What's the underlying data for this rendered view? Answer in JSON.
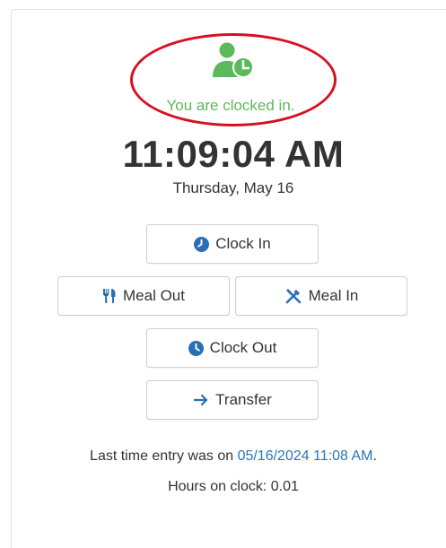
{
  "status": {
    "text": "You are clocked in.",
    "icon": "user-clock-icon",
    "color": "#5cb85c",
    "highlight_color": "#d8101e"
  },
  "clock": {
    "time": "11:09:04 AM",
    "date": "Thursday, May 16"
  },
  "buttons": {
    "clock_in": {
      "label": "Clock In",
      "icon": "clock-icon"
    },
    "meal_out": {
      "label": "Meal Out",
      "icon": "utensils-icon"
    },
    "meal_in": {
      "label": "Meal In",
      "icon": "crossed-utensils-icon"
    },
    "clock_out": {
      "label": "Clock Out",
      "icon": "clock-icon"
    },
    "transfer": {
      "label": "Transfer",
      "icon": "arrow-right-icon"
    }
  },
  "footer": {
    "last_entry_prefix": "Last time entry was on ",
    "last_entry_datetime": "05/16/2024 11:08 AM",
    "last_entry_suffix": ".",
    "hours_on_clock": "Hours on clock: 0.01"
  },
  "colors": {
    "icon_blue": "#2a6fb4",
    "link_blue": "#2a74b6",
    "text": "#333333"
  }
}
